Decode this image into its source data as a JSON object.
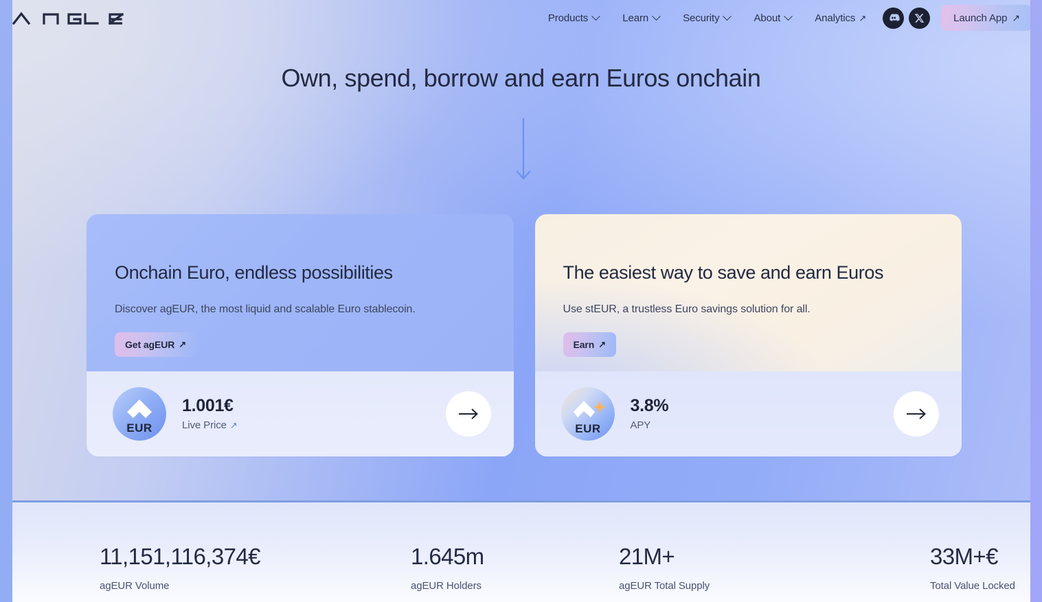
{
  "brand": {
    "name": "ANGLE",
    "logo_icon": "angle-logo"
  },
  "nav": {
    "items": [
      {
        "label": "Products",
        "icon": "chevron-down-icon",
        "external": false
      },
      {
        "label": "Learn",
        "icon": "chevron-down-icon",
        "external": false
      },
      {
        "label": "Security",
        "icon": "chevron-down-icon",
        "external": false
      },
      {
        "label": "About",
        "icon": "chevron-down-icon",
        "external": false
      },
      {
        "label": "Analytics",
        "icon": "arrow-up-right-icon",
        "external": true
      }
    ],
    "external_arrow": "↗",
    "social": [
      {
        "name": "discord-icon",
        "label": "Discord"
      },
      {
        "name": "x-icon",
        "label": "X"
      }
    ],
    "launch": {
      "label": "Launch App",
      "icon": "arrow-up-right-icon",
      "arrow": "↗",
      "gradient_from": "#e3c0ea",
      "gradient_to": "#a8c0f6"
    }
  },
  "hero": {
    "title": "Own, spend, borrow and earn Euros onchain",
    "scroll_hint_icon": "arrow-down-icon"
  },
  "cards": [
    {
      "id": "agEUR",
      "heading": "Onchain Euro, endless possibilities",
      "subheading": "Discover agEUR, the most liquid and scalable Euro stablecoin.",
      "cta": {
        "label": "Get agEUR",
        "arrow": "↗",
        "icon": "arrow-up-right-icon"
      },
      "token": {
        "icon": "ageur-token-icon",
        "symbol": "EUR"
      },
      "value": "1.001€",
      "value_label": "Live Price",
      "value_label_arrow": "↗",
      "go_icon": "arrow-right-icon"
    },
    {
      "id": "stEUR",
      "heading": "The easiest way to save and earn Euros",
      "subheading": "Use stEUR, a trustless Euro savings solution for all.",
      "cta": {
        "label": "Earn",
        "arrow": "↗",
        "icon": "arrow-up-right-icon"
      },
      "token": {
        "icon": "steur-token-icon",
        "symbol": "EUR"
      },
      "value": "3.8%",
      "value_label": "APY",
      "value_label_arrow": "",
      "go_icon": "arrow-right-icon"
    }
  ],
  "stats": [
    {
      "value": "11,151,116,374€",
      "label": "agEUR Volume"
    },
    {
      "value": "1.645m",
      "label": "agEUR Holders"
    },
    {
      "value": "21M+",
      "label": "agEUR Total Supply"
    },
    {
      "value": "33M+€",
      "label": "Total Value Locked"
    }
  ],
  "colors": {
    "text_dark": "#242a42",
    "text_muted": "#4a5270",
    "accent_blue": "#5b7fe0",
    "divider": "#7e9ee0",
    "frame": "#93adf5"
  }
}
